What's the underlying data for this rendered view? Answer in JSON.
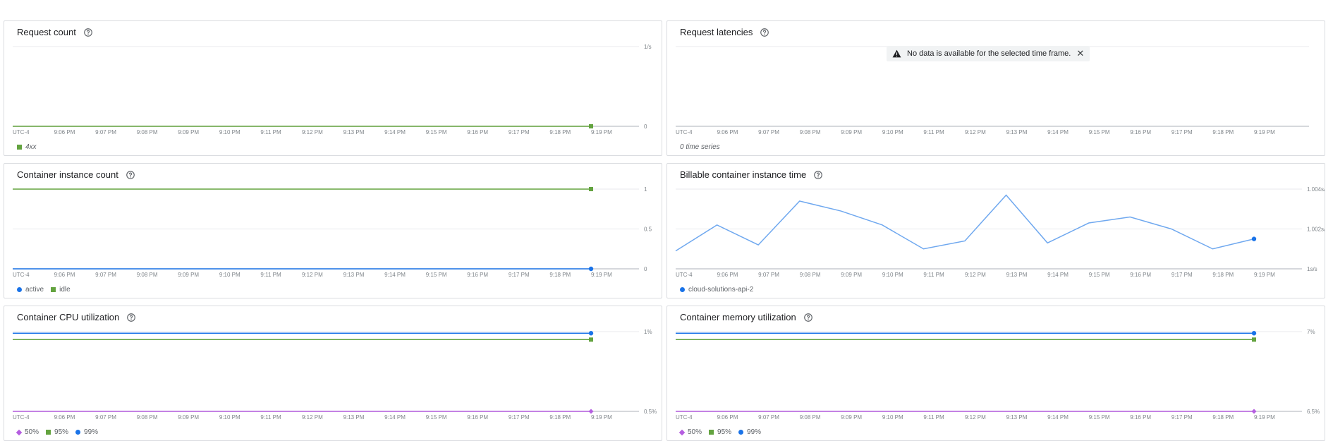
{
  "x_axis_labels": [
    "UTC-4",
    "9:06 PM",
    "9:07 PM",
    "9:08 PM",
    "9:09 PM",
    "9:10 PM",
    "9:11 PM",
    "9:12 PM",
    "9:13 PM",
    "9:14 PM",
    "9:15 PM",
    "9:16 PM",
    "9:17 PM",
    "9:18 PM",
    "9:19 PM"
  ],
  "colors": {
    "green": "#63a33f",
    "blue": "#1a73e8",
    "lightblue": "#6fa8ef",
    "purple": "#b55ee0",
    "grid": "#e8eaed",
    "axis": "#bdc1c6"
  },
  "panels": [
    {
      "title": "Request count",
      "help_icon": "help-circle-icon",
      "legend": [
        {
          "label": "4xx",
          "color": "#63a33f",
          "shape": "square",
          "italic": true
        }
      ]
    },
    {
      "title": "Request latencies",
      "help_icon": "help-circle-icon",
      "notice": "No data is available for the selected time frame.",
      "notice_icon": "warning-icon",
      "close_icon": "close-icon",
      "empty_label": "0 time series"
    },
    {
      "title": "Container instance count",
      "help_icon": "help-circle-icon",
      "legend": [
        {
          "label": "active",
          "color": "#1a73e8",
          "shape": "circle"
        },
        {
          "label": "idle",
          "color": "#63a33f",
          "shape": "square"
        }
      ]
    },
    {
      "title": "Billable container instance time",
      "help_icon": "help-circle-icon",
      "legend": [
        {
          "label": "cloud-solutions-api-2",
          "color": "#1a73e8",
          "shape": "circle"
        }
      ]
    },
    {
      "title": "Container CPU utilization",
      "help_icon": "help-circle-icon",
      "legend": [
        {
          "label": "50%",
          "color": "#b55ee0",
          "shape": "diamond"
        },
        {
          "label": "95%",
          "color": "#63a33f",
          "shape": "square"
        },
        {
          "label": "99%",
          "color": "#1a73e8",
          "shape": "circle"
        }
      ]
    },
    {
      "title": "Container memory utilization",
      "help_icon": "help-circle-icon",
      "legend": [
        {
          "label": "50%",
          "color": "#b55ee0",
          "shape": "diamond"
        },
        {
          "label": "95%",
          "color": "#63a33f",
          "shape": "square"
        },
        {
          "label": "99%",
          "color": "#1a73e8",
          "shape": "circle"
        }
      ]
    }
  ],
  "chart_data": [
    {
      "type": "line",
      "title": "Request count",
      "x": [
        "UTC-4",
        "9:06 PM",
        "9:07 PM",
        "9:08 PM",
        "9:09 PM",
        "9:10 PM",
        "9:11 PM",
        "9:12 PM",
        "9:13 PM",
        "9:14 PM",
        "9:15 PM",
        "9:16 PM",
        "9:17 PM",
        "9:18 PM",
        "9:19 PM"
      ],
      "y_ticks": [
        "1/s",
        "0"
      ],
      "ylim": [
        0,
        1
      ],
      "grid": true,
      "series": [
        {
          "name": "4xx",
          "color": "#63a33f",
          "marker": "square",
          "values": [
            0,
            0,
            0,
            0,
            0,
            0,
            0,
            0,
            0,
            0,
            0,
            0,
            0,
            0,
            0
          ]
        }
      ]
    },
    {
      "type": "line",
      "title": "Request latencies",
      "x": [
        "UTC-4",
        "9:06 PM",
        "9:07 PM",
        "9:08 PM",
        "9:09 PM",
        "9:10 PM",
        "9:11 PM",
        "9:12 PM",
        "9:13 PM",
        "9:14 PM",
        "9:15 PM",
        "9:16 PM",
        "9:17 PM",
        "9:18 PM",
        "9:19 PM"
      ],
      "y_ticks": [],
      "grid": true,
      "series": []
    },
    {
      "type": "line",
      "title": "Container instance count",
      "x": [
        "UTC-4",
        "9:06 PM",
        "9:07 PM",
        "9:08 PM",
        "9:09 PM",
        "9:10 PM",
        "9:11 PM",
        "9:12 PM",
        "9:13 PM",
        "9:14 PM",
        "9:15 PM",
        "9:16 PM",
        "9:17 PM",
        "9:18 PM",
        "9:19 PM"
      ],
      "y_ticks": [
        "1",
        "0.5",
        "0"
      ],
      "ylim": [
        0,
        1
      ],
      "grid": true,
      "series": [
        {
          "name": "idle",
          "color": "#63a33f",
          "marker": "square",
          "values": [
            1,
            1,
            1,
            1,
            1,
            1,
            1,
            1,
            1,
            1,
            1,
            1,
            1,
            1,
            1
          ]
        },
        {
          "name": "active",
          "color": "#1a73e8",
          "marker": "circle",
          "values": [
            0,
            0,
            0,
            0,
            0,
            0,
            0,
            0,
            0,
            0,
            0,
            0,
            0,
            0,
            0
          ]
        }
      ]
    },
    {
      "type": "line",
      "title": "Billable container instance time",
      "x": [
        "UTC-4",
        "9:06 PM",
        "9:07 PM",
        "9:08 PM",
        "9:09 PM",
        "9:10 PM",
        "9:11 PM",
        "9:12 PM",
        "9:13 PM",
        "9:14 PM",
        "9:15 PM",
        "9:16 PM",
        "9:17 PM",
        "9:18 PM",
        "9:19 PM"
      ],
      "y_ticks": [
        "1.004s/s",
        "1.002s/s",
        "1s/s"
      ],
      "ylim": [
        1.0,
        1.004
      ],
      "grid": true,
      "series": [
        {
          "name": "cloud-solutions-api-2",
          "color": "#6fa8ef",
          "marker": "circle",
          "values": [
            1.0009,
            1.0022,
            1.0012,
            1.0034,
            1.0029,
            1.0022,
            1.001,
            1.0014,
            1.0037,
            1.0013,
            1.0023,
            1.0026,
            1.002,
            1.001,
            1.0015
          ]
        }
      ]
    },
    {
      "type": "line",
      "title": "Container CPU utilization",
      "x": [
        "UTC-4",
        "9:06 PM",
        "9:07 PM",
        "9:08 PM",
        "9:09 PM",
        "9:10 PM",
        "9:11 PM",
        "9:12 PM",
        "9:13 PM",
        "9:14 PM",
        "9:15 PM",
        "9:16 PM",
        "9:17 PM",
        "9:18 PM",
        "9:19 PM"
      ],
      "y_ticks": [
        "1%",
        "0.5%"
      ],
      "ylim": [
        0.5,
        1
      ],
      "grid": true,
      "series": [
        {
          "name": "99%",
          "color": "#1a73e8",
          "marker": "circle",
          "values": [
            0.99,
            0.99,
            0.99,
            0.99,
            0.99,
            0.99,
            0.99,
            0.99,
            0.99,
            0.99,
            0.99,
            0.99,
            0.99,
            0.99,
            0.99
          ]
        },
        {
          "name": "95%",
          "color": "#63a33f",
          "marker": "square",
          "values": [
            0.95,
            0.95,
            0.95,
            0.95,
            0.95,
            0.95,
            0.95,
            0.95,
            0.95,
            0.95,
            0.95,
            0.95,
            0.95,
            0.95,
            0.95
          ]
        },
        {
          "name": "50%",
          "color": "#b55ee0",
          "marker": "diamond",
          "values": [
            0.5,
            0.5,
            0.5,
            0.5,
            0.5,
            0.5,
            0.5,
            0.5,
            0.5,
            0.5,
            0.5,
            0.5,
            0.5,
            0.5,
            0.5
          ]
        }
      ]
    },
    {
      "type": "line",
      "title": "Container memory utilization",
      "x": [
        "UTC-4",
        "9:06 PM",
        "9:07 PM",
        "9:08 PM",
        "9:09 PM",
        "9:10 PM",
        "9:11 PM",
        "9:12 PM",
        "9:13 PM",
        "9:14 PM",
        "9:15 PM",
        "9:16 PM",
        "9:17 PM",
        "9:18 PM",
        "9:19 PM"
      ],
      "y_ticks": [
        "7%",
        "6.5%"
      ],
      "ylim": [
        6.5,
        7
      ],
      "grid": true,
      "series": [
        {
          "name": "99%",
          "color": "#1a73e8",
          "marker": "circle",
          "values": [
            6.99,
            6.99,
            6.99,
            6.99,
            6.99,
            6.99,
            6.99,
            6.99,
            6.99,
            6.99,
            6.99,
            6.99,
            6.99,
            6.99,
            6.99
          ]
        },
        {
          "name": "95%",
          "color": "#63a33f",
          "marker": "square",
          "values": [
            6.95,
            6.95,
            6.95,
            6.95,
            6.95,
            6.95,
            6.95,
            6.95,
            6.95,
            6.95,
            6.95,
            6.95,
            6.95,
            6.95,
            6.95
          ]
        },
        {
          "name": "50%",
          "color": "#b55ee0",
          "marker": "diamond",
          "values": [
            6.5,
            6.5,
            6.5,
            6.5,
            6.5,
            6.5,
            6.5,
            6.5,
            6.5,
            6.5,
            6.5,
            6.5,
            6.5,
            6.5,
            6.5
          ]
        }
      ]
    }
  ]
}
